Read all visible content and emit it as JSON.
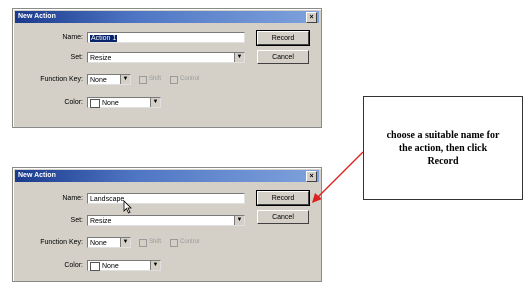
{
  "dialog_top": {
    "title": "New Action",
    "close_glyph": "×",
    "labels": {
      "name": "Name:",
      "set": "Set:",
      "function_key": "Function Key:",
      "color": "Color:"
    },
    "name_value": "Action 1",
    "set_value": "Resize",
    "function_key_value": "None",
    "shift_label": "Shift",
    "control_label": "Control",
    "color_value": "None",
    "buttons": {
      "record": "Record",
      "cancel": "Cancel"
    }
  },
  "dialog_bottom": {
    "title": "New Action",
    "close_glyph": "×",
    "labels": {
      "name": "Name:",
      "set": "Set:",
      "function_key": "Function Key:",
      "color": "Color:"
    },
    "name_value": "Landscape",
    "set_value": "Resize",
    "function_key_value": "None",
    "shift_label": "Shift",
    "control_label": "Control",
    "color_value": "None",
    "buttons": {
      "record": "Record",
      "cancel": "Cancel"
    }
  },
  "callout": {
    "line1": "choose a suitable name for",
    "line2": "the action, then click",
    "line3": "Record"
  },
  "colors": {
    "arrow": "#d9231f",
    "titlebar": "#1b3a8c",
    "dialog_bg": "#d4d0c8"
  }
}
